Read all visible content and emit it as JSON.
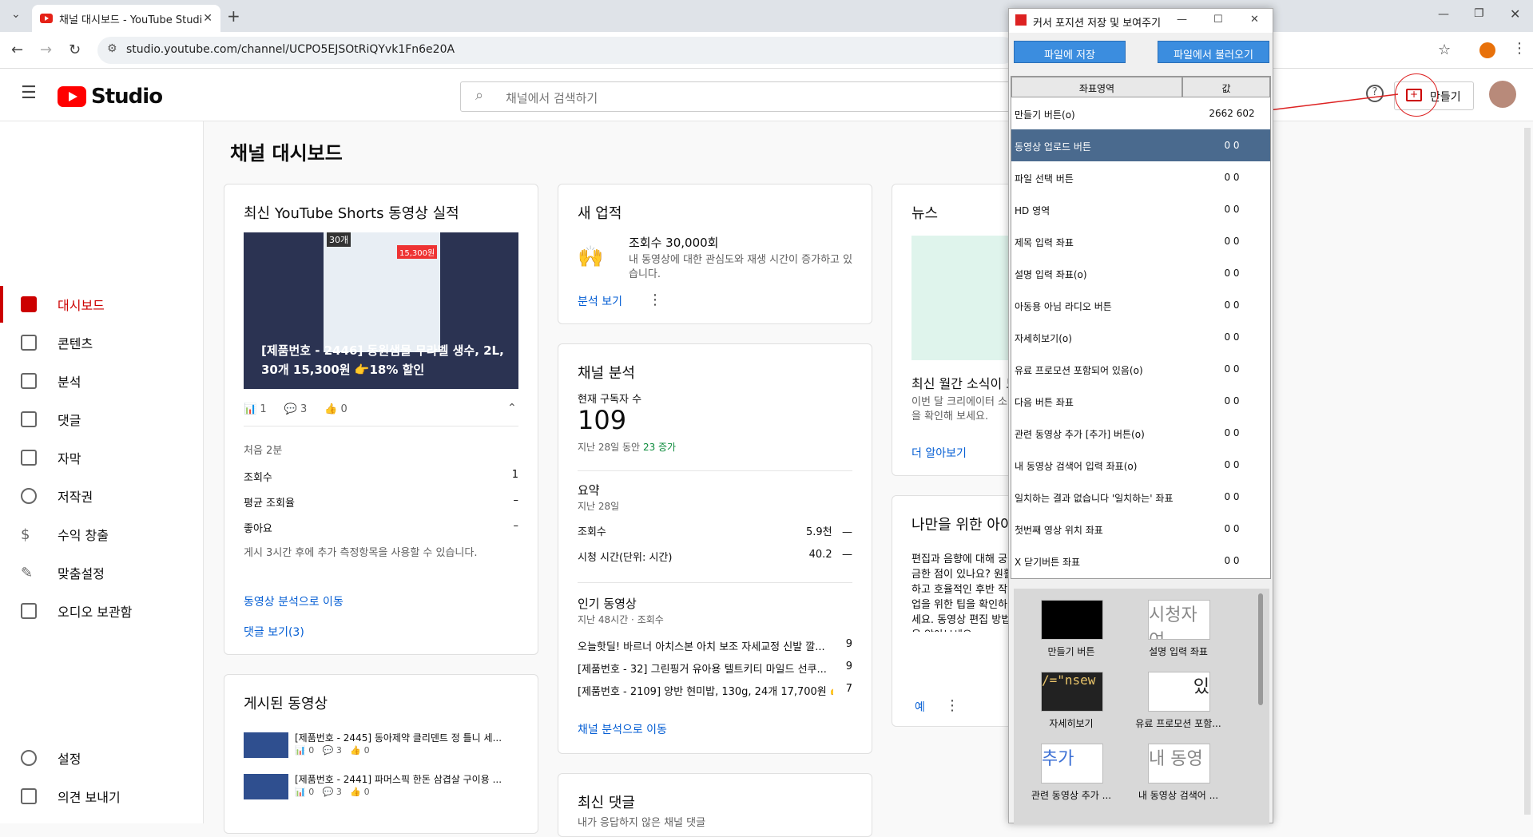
{
  "browser": {
    "tab_title": "채널 대시보드 - YouTube Studi",
    "url": "studio.youtube.com/channel/UCPO5EJSOtRiQYvk1Fn6e20A"
  },
  "header": {
    "logo_text": "Studio",
    "search_placeholder": "채널에서 검색하기",
    "create_label": "만들기"
  },
  "sidebar": {
    "items": [
      {
        "label": "대시보드"
      },
      {
        "label": "콘텐츠"
      },
      {
        "label": "분석"
      },
      {
        "label": "댓글"
      },
      {
        "label": "자막"
      },
      {
        "label": "저작권"
      },
      {
        "label": "수익 창출"
      },
      {
        "label": "맞춤설정"
      },
      {
        "label": "오디오 보관함"
      }
    ],
    "bottom": [
      {
        "label": "설정"
      },
      {
        "label": "의견 보내기"
      }
    ]
  },
  "page_title": "채널 대시보드",
  "shorts_card": {
    "title": "최신 YouTube Shorts 동영상 실적",
    "thumb_caption": "[제품번호 - 2446] 동원샘물 무라벨 생수, 2L, 30개 15,300원 👉18% 할인",
    "thumb_badge": "30개",
    "thumb_price": "15,300원",
    "views": "1",
    "comments": "3",
    "likes": "0",
    "period": "처음 2분",
    "stats": [
      {
        "label": "조회수",
        "value": "1"
      },
      {
        "label": "평균 조회율",
        "value": "–"
      },
      {
        "label": "좋아요",
        "value": "–"
      }
    ],
    "note": "게시 3시간 후에 추가 측정항목을 사용할 수 있습니다.",
    "link1": "동영상 분석으로 이동",
    "link2": "댓글 보기(3)"
  },
  "published_card": {
    "title": "게시된 동영상",
    "videos": [
      {
        "title": "[제품번호 - 2445] 동아제약 클리덴트 정 틀니 세...",
        "views": "0",
        "comments": "3",
        "likes": "0"
      },
      {
        "title": "[제품번호 - 2441] 파머스픽 한돈 삼겹살 구이용 ...",
        "views": "0",
        "comments": "3",
        "likes": "0"
      }
    ]
  },
  "achievement_card": {
    "title": "새 업적",
    "headline": "조회수 30,000회",
    "body": "내 동영상에 대한 관심도와 재생 시간이 증가하고 있습니다.",
    "link": "분석 보기"
  },
  "analytics_card": {
    "title": "채널 분석",
    "subs_label": "현재 구독자 수",
    "subs_value": "109",
    "subs_change_prefix": "지난 28일 동안",
    "subs_change": "23 증가",
    "summary_title": "요약",
    "summary_period": "지난 28일",
    "summary_rows": [
      {
        "label": "조회수",
        "value": "5.9천",
        "trend": "—"
      },
      {
        "label": "시청 시간(단위: 시간)",
        "value": "40.2",
        "trend": "—"
      }
    ],
    "popular_title": "인기 동영상",
    "popular_period": "지난 48시간 · 조회수",
    "popular": [
      {
        "title": "오늘핫딜! 바르너 아치스본 아치 보조 자세교정 신발 깔...",
        "views": "9"
      },
      {
        "title": "[제품번호 - 32] 그린핑거 유아용 텔트키티 마일드 선쿠...",
        "views": "9"
      },
      {
        "title": "[제품번호 - 2109] 양반 현미밥, 130g, 24개 17,700원 👉...",
        "views": "7"
      }
    ],
    "link": "채널 분석으로 이동"
  },
  "comments_card": {
    "title": "최신 댓글",
    "subtitle": "내가 응답하지 않은 채널 댓글"
  },
  "news_card": {
    "title": "뉴스",
    "headline": "최신 월간 소식이 도",
    "body": "이번 달 크리에이터 소식을 확인해 보세요.",
    "link": "더 알아보기"
  },
  "foryou_card": {
    "title": "나만을 위한 아이",
    "body": "편집과 음향에 대해 궁금한 점이 있나요? 원활하고 호율적인 후반 작업을 위한 팁을 확인하세요. 동영상 편집 방법을 알아보세요.",
    "link": "예"
  },
  "tool": {
    "title": "커서 포지션 저장 및 보여주기",
    "save_btn": "파일에 저장",
    "load_btn": "파일에서 불러오기",
    "col_key": "좌표영역",
    "col_val": "값",
    "rows": [
      {
        "k": "만들기 버튼(o)",
        "v": "2662 602"
      },
      {
        "k": "동영상 업로드 버튼",
        "v": "0 0"
      },
      {
        "k": "파일 선택 버튼",
        "v": "0 0"
      },
      {
        "k": "HD 영역",
        "v": "0 0"
      },
      {
        "k": "제목 입력 좌표",
        "v": "0 0"
      },
      {
        "k": "설명 입력 좌표(o)",
        "v": "0 0"
      },
      {
        "k": "아동용 아님 라디오 버튼",
        "v": "0 0"
      },
      {
        "k": "자세히보기(o)",
        "v": "0 0"
      },
      {
        "k": "유료 프로모션 포함되어 있음(o)",
        "v": "0 0"
      },
      {
        "k": "다음 버튼 좌표",
        "v": "0 0"
      },
      {
        "k": "관련 동영상 추가 [추가] 버튼(o)",
        "v": "0 0"
      },
      {
        "k": "내 동영상 검색어 입력 좌표(o)",
        "v": "0 0"
      },
      {
        "k": "일치하는 결과 없습니다 '일치하는' 좌표",
        "v": "0 0"
      },
      {
        "k": "첫번째 영상 위치 좌표",
        "v": "0 0"
      },
      {
        "k": "X 닫기버튼 좌표",
        "v": "0 0"
      }
    ],
    "thumbs": [
      {
        "img": "",
        "label": "만들기 버튼"
      },
      {
        "img": "시청자여",
        "label": "설명 입력 좌표"
      },
      {
        "img": "/=\"nsew",
        "label": "자세히보기"
      },
      {
        "img": "있",
        "label": "유료 프로모션 포함..."
      },
      {
        "img": "추가",
        "label": "관련 동영상 추가 ..."
      },
      {
        "img": "내 동영",
        "label": "내 동영상 검색어 ..."
      }
    ]
  }
}
